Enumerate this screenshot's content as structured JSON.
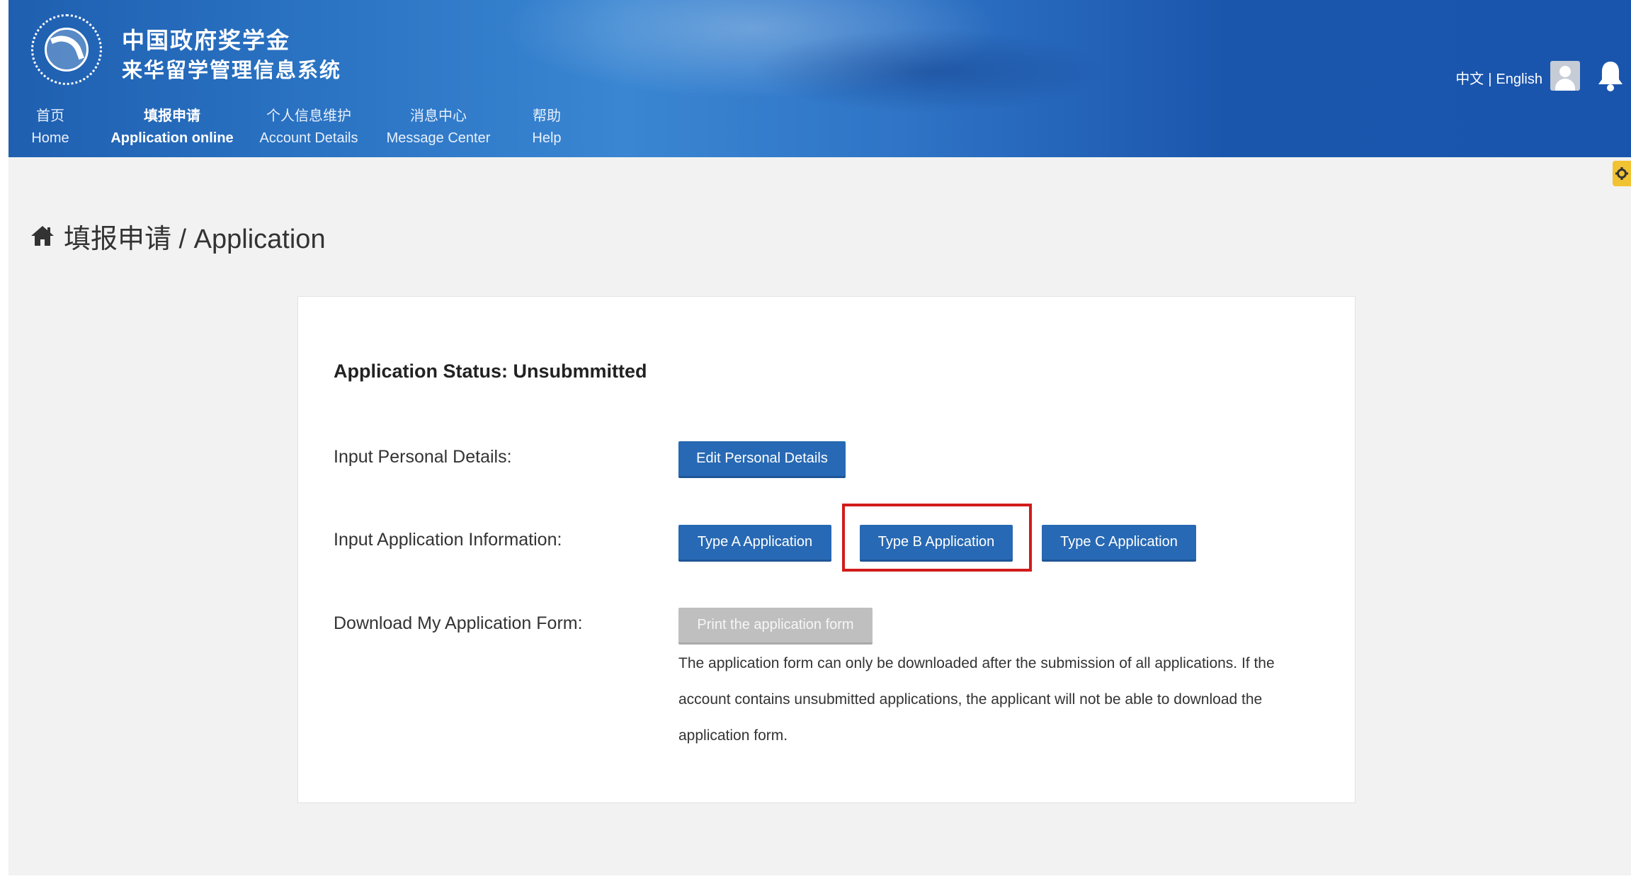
{
  "header": {
    "title_cn": "中国政府奖学金",
    "subtitle_cn": "来华留学管理信息系统",
    "lang_cn": "中文",
    "lang_sep": "|",
    "lang_en": "English",
    "icons": {
      "logo": "csc-logo",
      "user": "user-icon",
      "notifications": "bell-icon"
    }
  },
  "nav": {
    "items": [
      {
        "cn": "首页",
        "en": "Home",
        "active": false
      },
      {
        "cn": "填报申请",
        "en": "Application online",
        "active": true
      },
      {
        "cn": "个人信息维护",
        "en": "Account Details",
        "active": false
      },
      {
        "cn": "消息中心",
        "en": "Message Center",
        "active": false
      },
      {
        "cn": "帮助",
        "en": "Help",
        "active": false
      }
    ]
  },
  "breadcrumb": {
    "text": "填报申请 / Application",
    "icon": "home-icon"
  },
  "panel": {
    "status_text": "Application Status: Unsubmmitted",
    "rows": {
      "personal_label": "Input Personal Details:",
      "application_label": "Input Application Information:",
      "download_label": "Download My Application Form:"
    },
    "buttons": {
      "edit_personal": "Edit Personal Details",
      "type_a": "Type A Application",
      "type_b": "Type B Application",
      "type_c": "Type C Application",
      "print_form": "Print the application form"
    },
    "note_lines": [
      "The application form can only be downloaded after the submission of all applications. If the",
      "account contains unsubmitted applications, the applicant will not be able to download the",
      "application form."
    ]
  },
  "colors": {
    "header_blue": "#2b74c4",
    "button_blue": "#2769b4",
    "button_disabled": "#bfbfbf",
    "highlight_red": "#d21b1b",
    "settings_tab": "#f1c232"
  }
}
